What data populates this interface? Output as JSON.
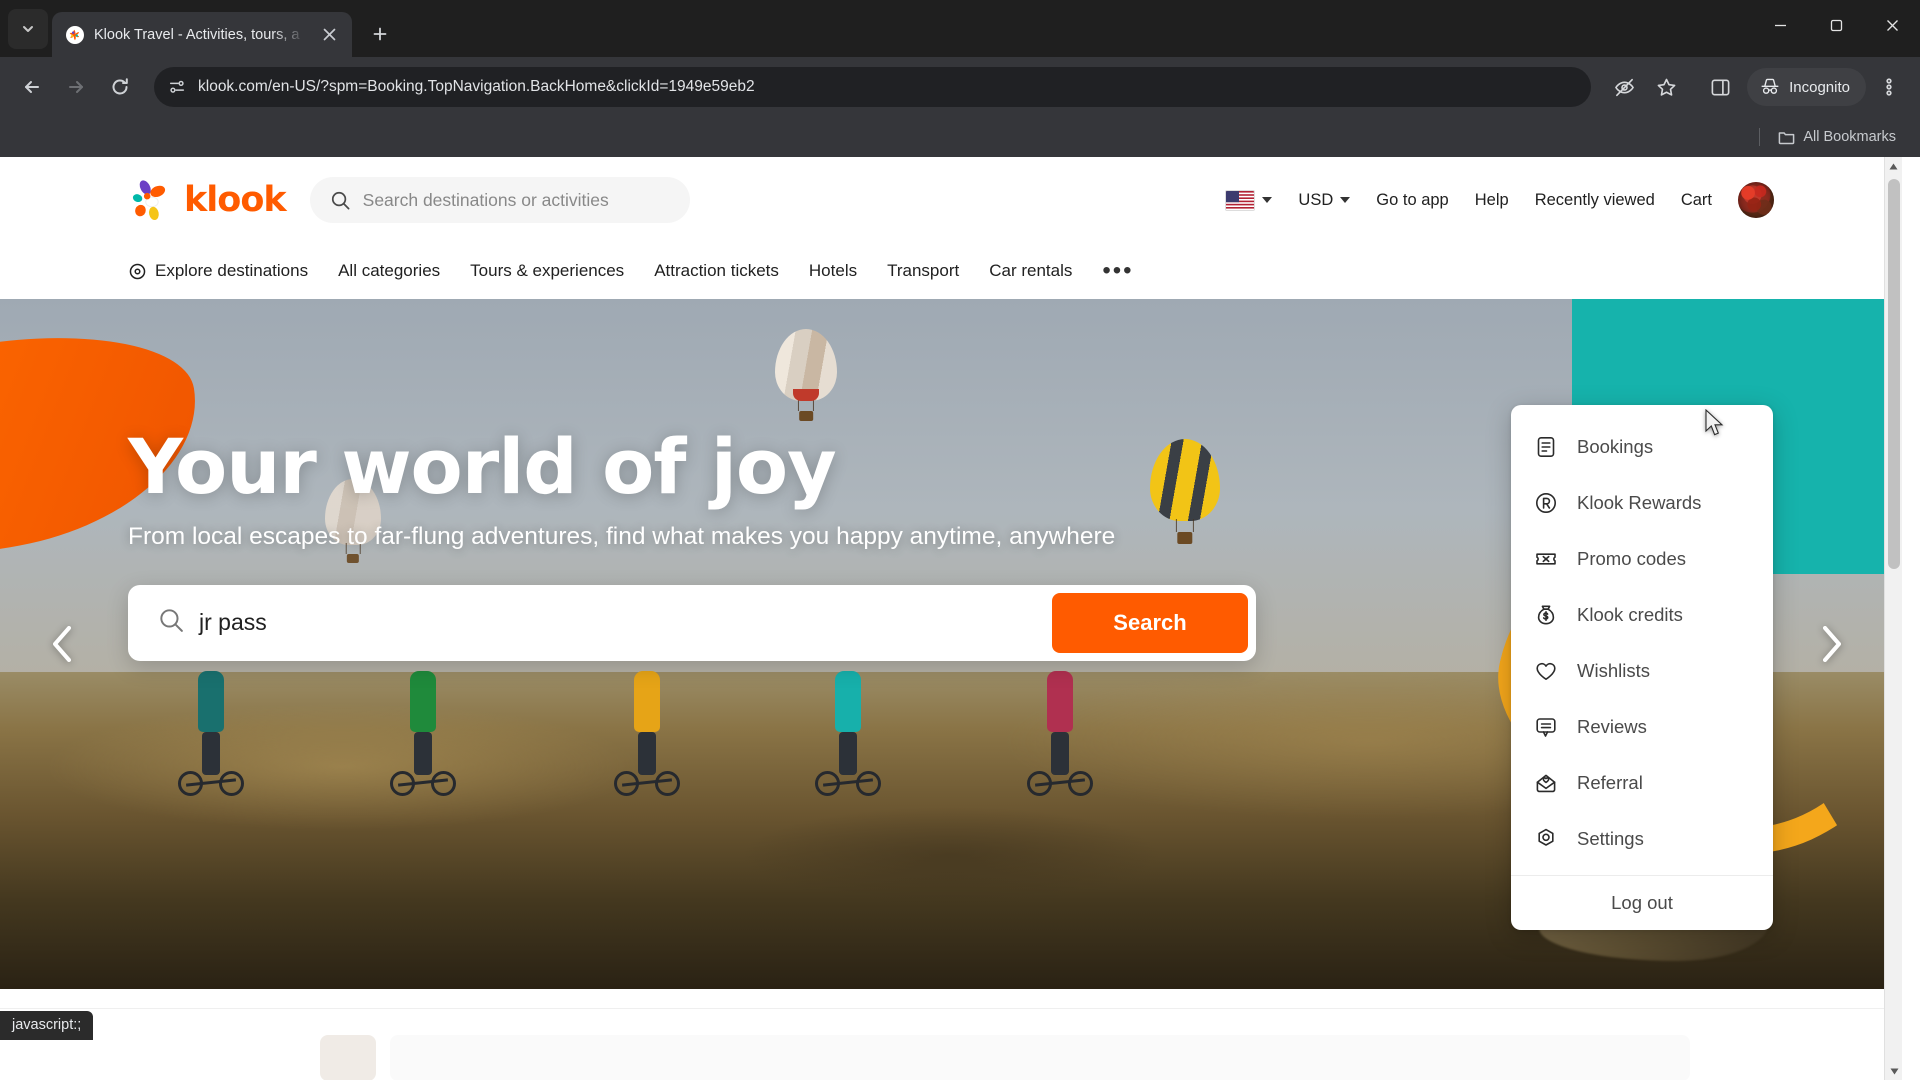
{
  "browser": {
    "tab": {
      "title": "Klook Travel - Activities, tours, a",
      "favicon_name": "klook-favicon",
      "close_label": "Close tab"
    },
    "new_tab_label": "New tab",
    "tab_search_label": "Search tabs",
    "nav": {
      "back_label": "Back",
      "forward_label": "Forward",
      "reload_label": "Reload"
    },
    "omnibox": {
      "url": "klook.com/en-US/?spm=Booking.TopNavigation.BackHome&clickId=1949e59eb2",
      "site_info_label": "View site information"
    },
    "toolbar": {
      "tracking_protection_label": "Tracking protection",
      "bookmark_label": "Bookmark this tab",
      "side_panel_label": "Side panel",
      "incognito_label": "Incognito",
      "menu_label": "Customize and control Google Chrome"
    },
    "bookmarks": {
      "all_bookmarks_label": "All Bookmarks"
    },
    "window_controls": {
      "minimize_label": "Minimize",
      "maximize_label": "Maximize",
      "close_label": "Close"
    },
    "status_bubble": "javascript:;"
  },
  "site": {
    "logo_text": "klook",
    "header_search": {
      "placeholder": "Search destinations or activities",
      "value": ""
    },
    "header_links": [
      {
        "label": "Go to app"
      },
      {
        "label": "Help"
      },
      {
        "label": "Recently viewed"
      },
      {
        "label": "Cart"
      }
    ],
    "locale": {
      "region": "US",
      "currency": "USD"
    },
    "avatar_label": "Account",
    "categories": [
      {
        "label": "Explore destinations",
        "icon": "location-pin-icon"
      },
      {
        "label": "All categories",
        "icon": ""
      },
      {
        "label": "Tours & experiences",
        "icon": ""
      },
      {
        "label": "Attraction tickets",
        "icon": ""
      },
      {
        "label": "Hotels",
        "icon": ""
      },
      {
        "label": "Transport",
        "icon": ""
      },
      {
        "label": "Car rentals",
        "icon": ""
      }
    ],
    "categories_more_label": "•••"
  },
  "hero": {
    "title": "Your world of joy",
    "subtitle": "From local escapes to far-flung adventures, find what makes you happy anytime, anywhere",
    "search": {
      "value": "jr pass",
      "placeholder": "Search destinations or activities",
      "button_label": "Search"
    },
    "prev_label": "Previous slide",
    "next_label": "Next slide",
    "colors": {
      "orange": "#ff5b00",
      "teal": "#16b3ac",
      "yellow": "#f4a71b"
    }
  },
  "account_menu": {
    "items": [
      {
        "label": "Bookings",
        "icon": "document-list-icon"
      },
      {
        "label": "Klook Rewards",
        "icon": "circled-r-icon"
      },
      {
        "label": "Promo codes",
        "icon": "ticket-icon"
      },
      {
        "label": "Klook credits",
        "icon": "money-bag-icon"
      },
      {
        "label": "Wishlists",
        "icon": "heart-icon"
      },
      {
        "label": "Reviews",
        "icon": "speech-bubble-icon"
      },
      {
        "label": "Referral",
        "icon": "envelope-heart-icon"
      },
      {
        "label": "Settings",
        "icon": "gear-icon"
      }
    ],
    "logout_label": "Log out"
  }
}
